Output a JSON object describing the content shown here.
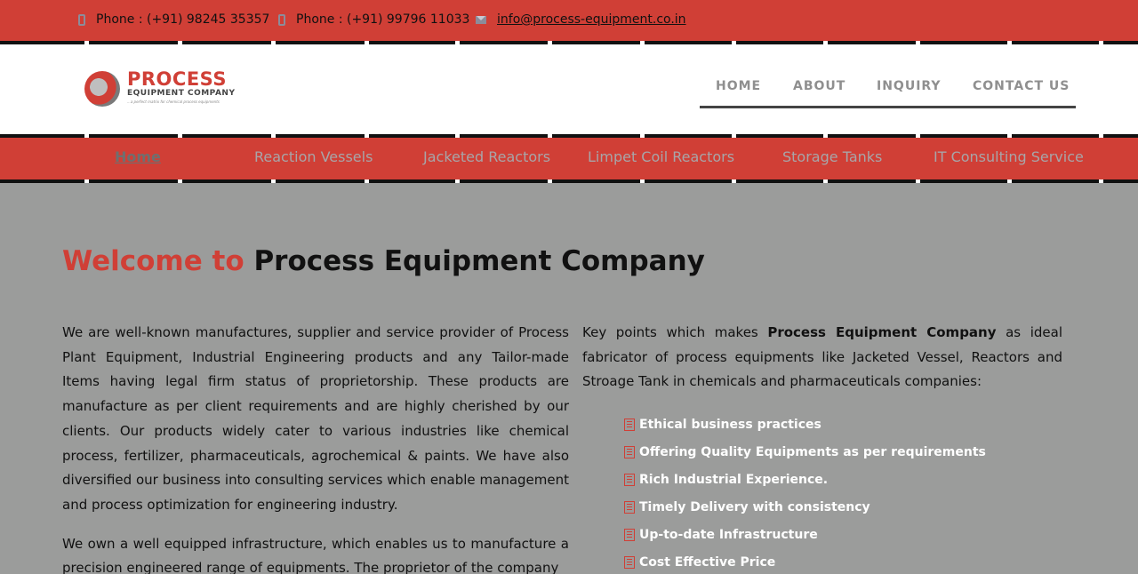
{
  "contact": {
    "phone1": "Phone : (+91) 98245 35357",
    "phone2": "Phone : (+91) 99796 11033",
    "email": "info@process-equipment.co.in"
  },
  "logo": {
    "name": "PROCESS",
    "subname": "EQUIPMENT COMPANY",
    "tagline": "...a perfect matrix for chemical process equipments"
  },
  "topnav": {
    "home": "HOME",
    "about": "ABOUT",
    "inquiry": "INQUIRY",
    "contact": "CONTACT US"
  },
  "menu": [
    "Home",
    "Reaction Vessels",
    "Jacketed Reactors",
    "Limpet Coil Reactors",
    "Storage Tanks",
    "IT Consulting Service"
  ],
  "welcome": {
    "prefix": "Welcome to",
    "company": "Process Equipment Company"
  },
  "left_paragraphs": [
    "We are well-known manufactures, supplier and service provider of Process Plant Equipment, Industrial Engineering products and any Tailor-made Items having legal firm status of proprietorship. These products are manufacture as per client requirements and are highly cherished by our clients. Our products widely cater to various industries like chemical process, fertilizer, pharmaceuticals, agrochemical & paints. We have also diversified our business into consulting services which enable management and process optimization for engineering industry.",
    "We own a well equipped infrastructure, which enables us to manufacture a precision engineered range of equipments. The proprietor of the company"
  ],
  "right": {
    "intro_before": "Key points which makes",
    "intro_bold": "Process Equipment Company",
    "intro_after": "as ideal fabricator of process equipments like Jacketed Vessel, Reactors and Stroage Tank in chemicals and pharmaceuticals companies:",
    "points": [
      "Ethical business practices",
      "Offering Quality Equipments as per requirements",
      "Rich Industrial Experience.",
      "Timely Delivery with consistency",
      "Up-to-date Infrastructure",
      "Cost Effective Price"
    ]
  },
  "colors": {
    "brand_red": "#d03f36",
    "background": "#9b9c9b"
  }
}
